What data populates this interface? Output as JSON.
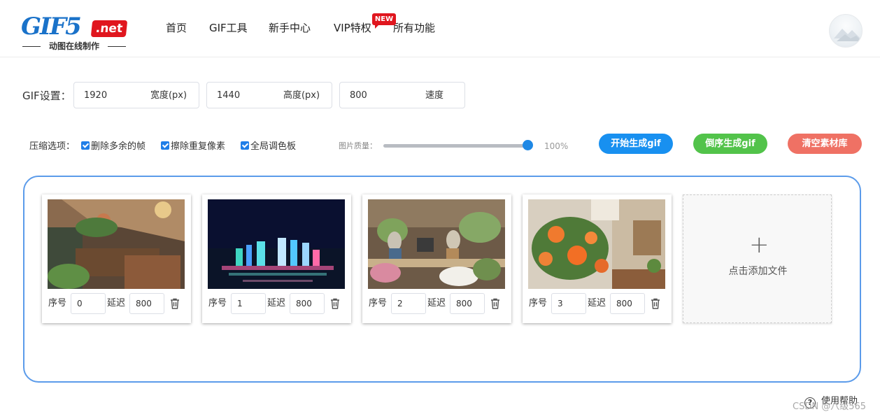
{
  "logo": {
    "main": "GIF5",
    "net": ".net",
    "sub": "动图在线制作"
  },
  "nav": {
    "items": [
      {
        "label": "首页"
      },
      {
        "label": "GIF工具"
      },
      {
        "label": "新手中心"
      },
      {
        "label": "VIP特权"
      },
      {
        "label": "所有功能"
      }
    ],
    "vip_badge": "NEW"
  },
  "settings": {
    "label": "GIF设置：",
    "width": {
      "value": "1920",
      "suffix": "宽度(px)"
    },
    "height": {
      "value": "1440",
      "suffix": "高度(px)"
    },
    "speed": {
      "value": "800",
      "suffix": "速度"
    }
  },
  "compress": {
    "label": "压缩选项：",
    "options": [
      {
        "label": "删除多余的帧",
        "checked": true
      },
      {
        "label": "擦除重复像素",
        "checked": true
      },
      {
        "label": "全局调色板",
        "checked": true
      }
    ],
    "quality_label": "图片质量：",
    "quality_value": "100%",
    "quality_level": 1.0
  },
  "buttons": {
    "start": "开始生成gif",
    "reverse": "倒序生成gif",
    "clear": "清空素材库"
  },
  "frames": [
    {
      "index_label": "序号",
      "index": "0",
      "delay_label": "延迟",
      "delay": "800",
      "image": "restaurant-interior"
    },
    {
      "index_label": "序号",
      "index": "1",
      "delay_label": "延迟",
      "delay": "800",
      "image": "city-night-skyline"
    },
    {
      "index_label": "序号",
      "index": "2",
      "delay_label": "延迟",
      "delay": "800",
      "image": "rabbit-figurines-shop"
    },
    {
      "index_label": "序号",
      "index": "3",
      "delay_label": "延迟",
      "delay": "800",
      "image": "orange-roses-cafe"
    }
  ],
  "add_file": {
    "plus": "+",
    "label": "点击添加文件"
  },
  "help": {
    "icon": "?",
    "label": "使用帮助"
  },
  "watermark": "CSDN @八级565",
  "colors": {
    "accent_blue": "#1890f0",
    "green": "#52c34a",
    "red": "#ef7164",
    "border_blue": "#5b9bea",
    "logo_red": "#e0161e",
    "logo_blue": "#1a72c9"
  }
}
